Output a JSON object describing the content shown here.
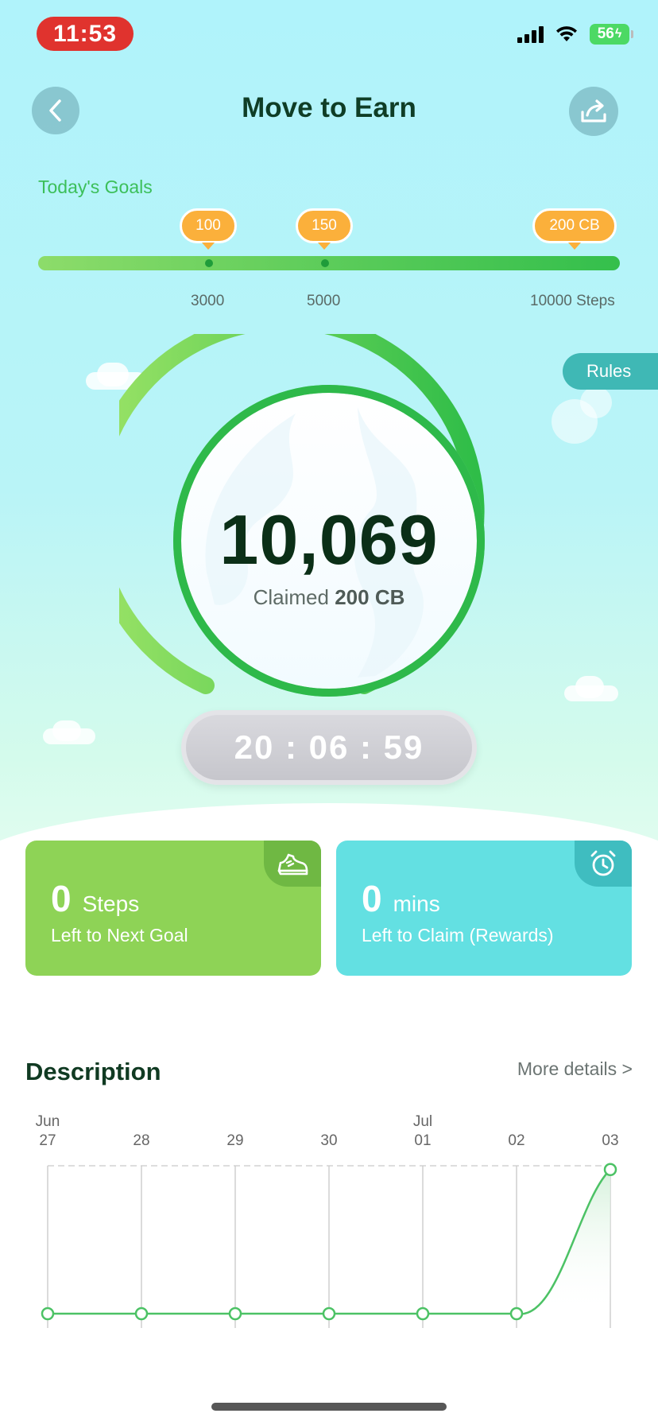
{
  "status_bar": {
    "time": "11:53",
    "battery": "56"
  },
  "header": {
    "title": "Move to Earn",
    "back_icon": "chevron-left-icon",
    "share_icon": "share-icon"
  },
  "goals": {
    "label": "Today's Goals",
    "milestones": [
      {
        "reward": "100",
        "steps": "3000"
      },
      {
        "reward": "150",
        "steps": "5000"
      },
      {
        "reward": "200 CB",
        "steps": "10000 Steps"
      }
    ]
  },
  "rules_button": "Rules",
  "gauge": {
    "value": "10,069",
    "claimed_label": "Claimed",
    "claimed_amount": "200 CB",
    "progress": 1.0
  },
  "timer": "20 : 06 : 59",
  "cards": {
    "steps": {
      "value": "0",
      "unit": "Steps",
      "subtitle": "Left to Next Goal",
      "icon": "sneaker-icon"
    },
    "mins": {
      "value": "0",
      "unit": "mins",
      "subtitle": "Left to Claim (Rewards)",
      "icon": "alarm-clock-icon"
    }
  },
  "description": {
    "title": "Description",
    "more_link": "More details >"
  },
  "chart_data": {
    "type": "area",
    "categories": [
      "27",
      "28",
      "29",
      "30",
      "01",
      "02",
      "03"
    ],
    "month_labels": [
      "Jun",
      "",
      "",
      "",
      "Jul",
      "",
      ""
    ],
    "values": [
      0,
      0,
      0,
      0,
      0,
      0,
      10069
    ],
    "ylim": [
      0,
      12000
    ],
    "grid": "vertical",
    "colors": {
      "line": "#4cc265",
      "fill": "#d6f1dc"
    }
  }
}
